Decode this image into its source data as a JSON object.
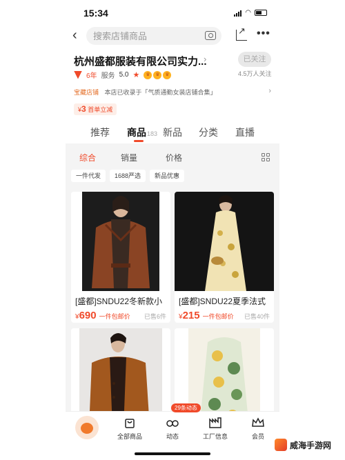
{
  "status": {
    "time": "15:34"
  },
  "search": {
    "placeholder": "搜索店铺商品"
  },
  "shop": {
    "name": "杭州盛都服装有限公司实力...",
    "follow_label": "已关注",
    "followers": "4.5万人关注",
    "years": "6年",
    "service_label": "服务",
    "service_score": "5.0",
    "collect_label": "宝藏店铺",
    "collect_text": "本店已收录于「气质通勤女装店铺合集」",
    "coupon_currency": "¥",
    "coupon_amount": "3",
    "coupon_text": "首单立减"
  },
  "tabs": [
    {
      "label": "推荐",
      "count": ""
    },
    {
      "label": "商品",
      "count": "183"
    },
    {
      "label": "新品",
      "count": ""
    },
    {
      "label": "分类",
      "count": ""
    },
    {
      "label": "直播",
      "count": ""
    }
  ],
  "sort": {
    "comprehensive": "综合",
    "sales": "销量",
    "price": "价格"
  },
  "filters": [
    "一件代发",
    "1688严选",
    "新品优惠"
  ],
  "products": [
    {
      "title": "[盛都]SNDU22冬新款小",
      "currency": "¥",
      "price": "690",
      "shipping": "一件包邮价",
      "sold": "已售6件"
    },
    {
      "title": "[盛都]SNDU22夏季法式",
      "currency": "¥",
      "price": "215",
      "shipping": "一件包邮价",
      "sold": "已售40件"
    },
    {
      "title": "",
      "currency": "",
      "price": "",
      "shipping": "",
      "sold": ""
    },
    {
      "title": "",
      "currency": "",
      "price": "",
      "shipping": "",
      "sold": ""
    }
  ],
  "bottom_nav": {
    "all_products": "全部商品",
    "feed": "动态",
    "factory": "工厂信息",
    "member": "会员",
    "feed_badge": "29条动态"
  },
  "watermark": {
    "text": "威海手游网"
  },
  "colors": {
    "accent": "#f04a2a",
    "content_bg": "#f4f4f4"
  }
}
